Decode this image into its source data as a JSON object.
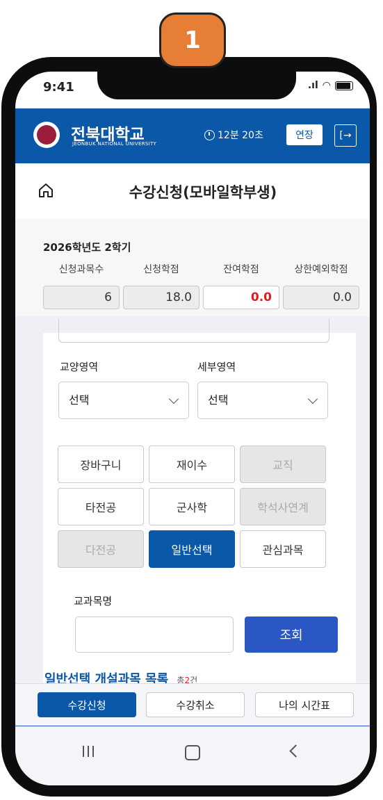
{
  "step_badge": "1",
  "status_bar": {
    "time": "9:41"
  },
  "header": {
    "university_name": "전북대학교",
    "university_subtitle": "JEONBUK NATIONAL UNIVERSITY",
    "timer_text": "12분 20초",
    "extend_label": "연장",
    "brand_color": "#0b57a8"
  },
  "page": {
    "title": "수강신청(모바일학부생)"
  },
  "summary": {
    "term": "2026학년도 2학기",
    "columns": [
      {
        "label": "신청과목수",
        "value": "6"
      },
      {
        "label": "신청학점",
        "value": "18.0"
      },
      {
        "label": "잔여학점",
        "value": "0.0"
      },
      {
        "label": "상한예외학점",
        "value": "0.0"
      }
    ]
  },
  "filters": {
    "area_label": "교양영역",
    "area_value": "선택",
    "subarea_label": "세부영역",
    "subarea_value": "선택"
  },
  "category_buttons": [
    {
      "label": "장바구니",
      "state": "normal"
    },
    {
      "label": "재이수",
      "state": "normal"
    },
    {
      "label": "교직",
      "state": "disabled"
    },
    {
      "label": "타전공",
      "state": "normal"
    },
    {
      "label": "군사학",
      "state": "normal"
    },
    {
      "label": "학석사연계",
      "state": "disabled"
    },
    {
      "label": "다전공",
      "state": "disabled"
    },
    {
      "label": "일반선택",
      "state": "active"
    },
    {
      "label": "관심과목",
      "state": "normal"
    }
  ],
  "search": {
    "label": "교과목명",
    "input_value": "",
    "button_label": "조회"
  },
  "list": {
    "title": "일반선택 개설과목 목록",
    "count_prefix": "총",
    "count": "2",
    "count_suffix": "건"
  },
  "tabs": [
    {
      "label": "수강신청",
      "active": true
    },
    {
      "label": "수강취소",
      "active": false
    },
    {
      "label": "나의 시간표",
      "active": false
    }
  ]
}
